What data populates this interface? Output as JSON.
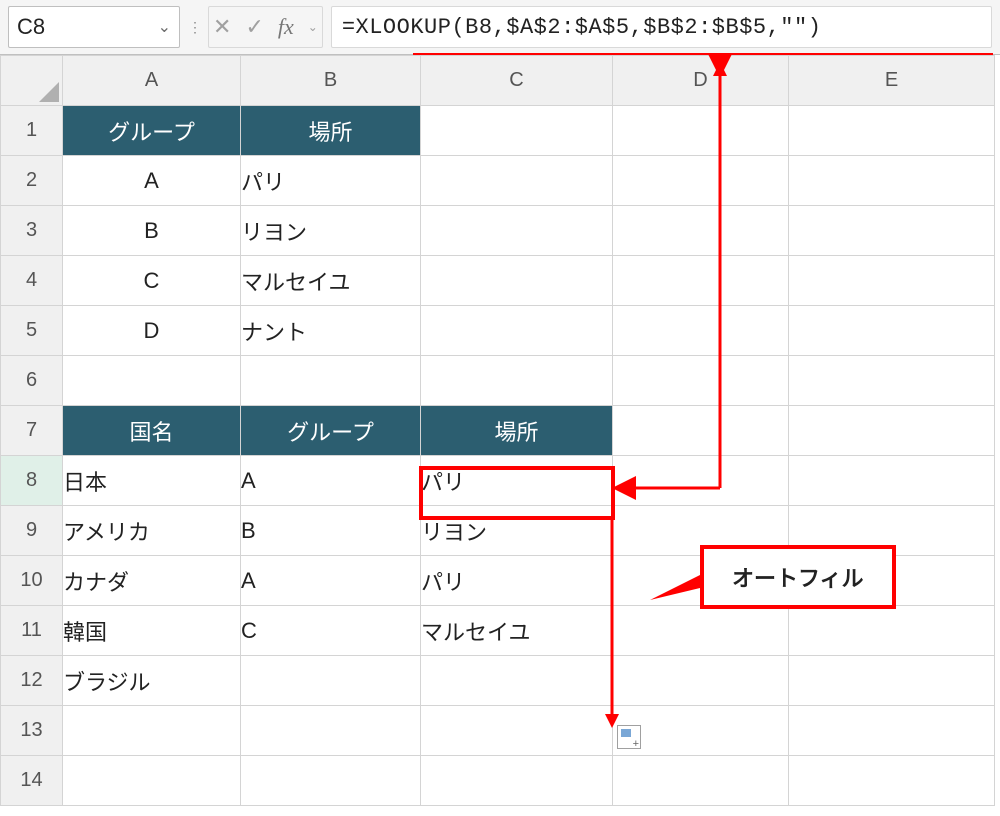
{
  "nameBox": "C8",
  "formula": "=XLOOKUP(B8,$A$2:$A$5,$B$2:$B$5,\"\")",
  "columns": [
    "A",
    "B",
    "C",
    "D",
    "E"
  ],
  "rowNumbers": [
    "1",
    "2",
    "3",
    "4",
    "5",
    "6",
    "7",
    "8",
    "9",
    "10",
    "11",
    "12",
    "13",
    "14"
  ],
  "table1": {
    "headers": [
      "グループ",
      "場所"
    ],
    "rows": [
      {
        "group": "A",
        "place": "パリ"
      },
      {
        "group": "B",
        "place": "リヨン"
      },
      {
        "group": "C",
        "place": "マルセイユ"
      },
      {
        "group": "D",
        "place": "ナント"
      }
    ]
  },
  "table2": {
    "headers": [
      "国名",
      "グループ",
      "場所"
    ],
    "rows": [
      {
        "country": "日本",
        "group": "A",
        "place": "パリ"
      },
      {
        "country": "アメリカ",
        "group": "B",
        "place": "リヨン"
      },
      {
        "country": "カナダ",
        "group": "A",
        "place": "パリ"
      },
      {
        "country": "韓国",
        "group": "C",
        "place": "マルセイユ"
      },
      {
        "country": "ブラジル",
        "group": "",
        "place": ""
      }
    ]
  },
  "annotation": {
    "label": "オートフィル"
  }
}
